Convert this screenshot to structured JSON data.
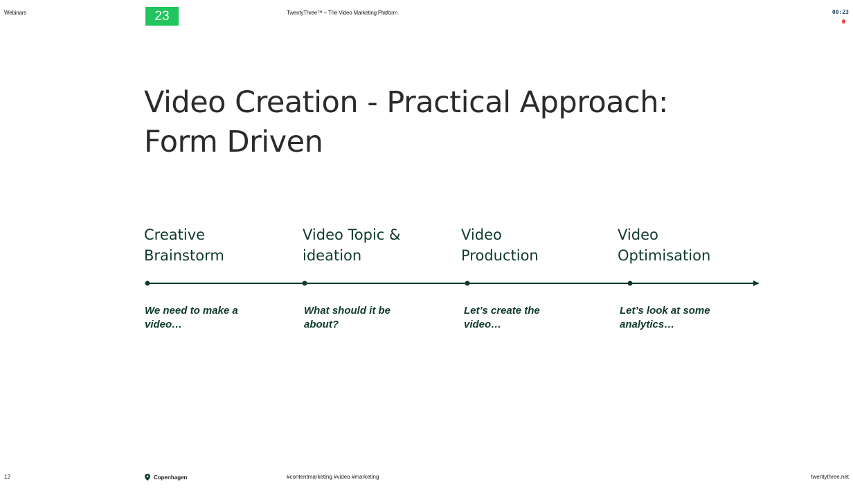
{
  "header": {
    "section": "Webinars",
    "logo_text": "23",
    "brand_tagline": "TwentyThree™ – The Video Marketing Platform",
    "timer": "00:23",
    "recording_indicator_color": "#f03c3c"
  },
  "slide": {
    "title_line1": "Video Creation - Practical Approach:",
    "title_line2": "Form Driven",
    "stages": [
      {
        "title": "Creative\nBrainstorm",
        "description": "We need to make a\nvideo…"
      },
      {
        "title": "Video Topic &\nideation",
        "description": "What should it be\nabout?"
      },
      {
        "title": "Video\nProduction",
        "description": "Let’s create the\nvideo…"
      },
      {
        "title": "Video\nOptimisation",
        "description": "Let’s look at some\nanalytics…"
      }
    ]
  },
  "footer": {
    "page_number": "12",
    "location_icon": "map-pin-icon",
    "location": "Copenhagen",
    "hashtags": "#contentmarketing #video #marketing",
    "website": "twentythree.net"
  },
  "colors": {
    "brand_green": "#21c55d",
    "text_dark_green": "#0f3a2c",
    "title_gray": "#2b2b2b"
  }
}
